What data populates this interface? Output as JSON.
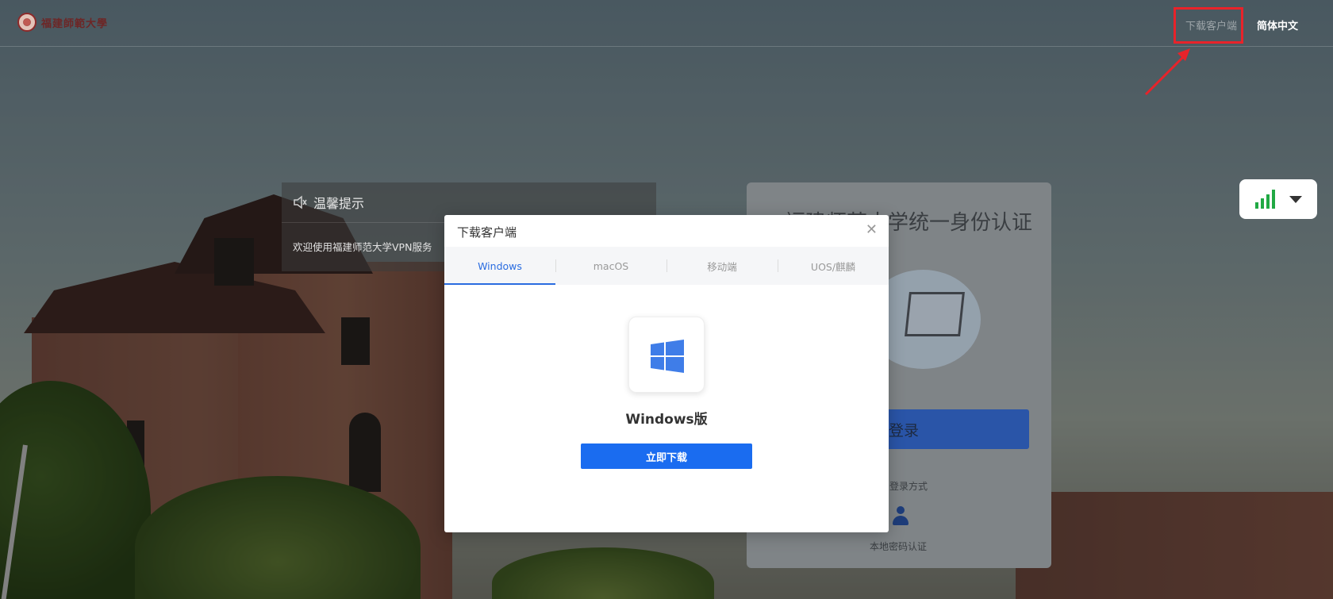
{
  "brand": {
    "logo_text": "福建師範大學"
  },
  "topbar": {
    "download_client": "下载客户端",
    "language": "简体中文"
  },
  "notice": {
    "title": "温馨提示",
    "message": "欢迎使用福建师范大学VPN服务",
    "icon": "speaker-icon"
  },
  "login": {
    "title": "福建师范大学统一身份认证",
    "login_button": "登录",
    "other_methods": "登录方式",
    "local_auth": "本地密码认证"
  },
  "network_widget": {
    "icon": "signal-bars-icon",
    "signal_color": "#21a944"
  },
  "modal": {
    "title": "下载客户端",
    "close": "✕",
    "tabs": [
      {
        "label": "Windows",
        "active": true
      },
      {
        "label": "macOS",
        "active": false
      },
      {
        "label": "移动端",
        "active": false
      },
      {
        "label": "UOS/麒麟",
        "active": false
      }
    ],
    "os_name": "Windows版",
    "download_button": "立即下载",
    "accent": "#1a6cf0"
  },
  "annotation": {
    "highlight_color": "#e8232a"
  }
}
